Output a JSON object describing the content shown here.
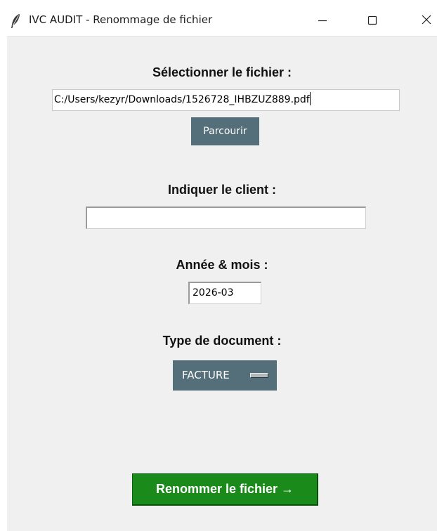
{
  "window": {
    "title": "IVC AUDIT - Renommage de fichier",
    "controls": {
      "minimize": "—",
      "maximize": "☐",
      "close": "✕"
    }
  },
  "file": {
    "label": "Sélectionner le fichier :",
    "path": "C:/Users/kezyr/Downloads/1526728_IHBZUZ889.pdf",
    "browse_label": "Parcourir"
  },
  "client": {
    "label": "Indiquer le client :",
    "value": ""
  },
  "period": {
    "label": "Année & mois :",
    "value": "2026-03"
  },
  "doc_type": {
    "label": "Type de document :",
    "selected": "FACTURE"
  },
  "action": {
    "rename_label": "Renommer le fichier →"
  },
  "colors": {
    "window_bg": "#f0f0f0",
    "button_slate": "#546e7a",
    "rename_green": "#1a8a1a"
  },
  "icons": {
    "app": "feather-icon",
    "minimize": "minimize-icon",
    "maximize": "maximize-icon",
    "close": "close-icon"
  }
}
